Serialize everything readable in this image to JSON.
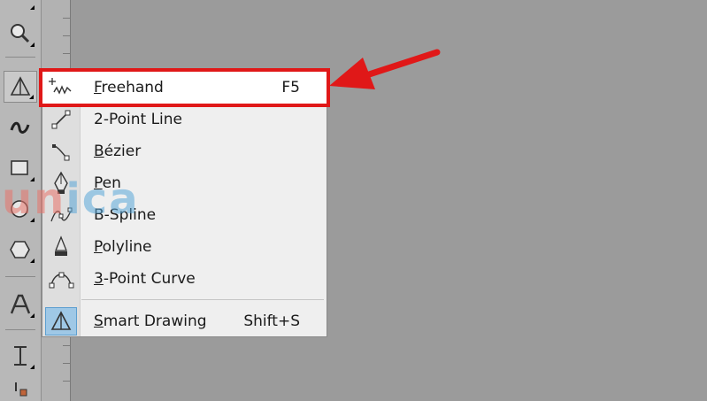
{
  "toolbox": {
    "tools": [
      {
        "name": "zoom-tool",
        "icon": "zoom-icon"
      },
      {
        "name": "freehand-tool",
        "icon": "freehand-triangle-icon",
        "active": true
      },
      {
        "name": "artistic-media-tool",
        "icon": "artistic-media-icon"
      },
      {
        "name": "rectangle-tool",
        "icon": "rectangle-icon"
      },
      {
        "name": "ellipse-tool",
        "icon": "ellipse-icon"
      },
      {
        "name": "polygon-tool",
        "icon": "polygon-icon"
      },
      {
        "name": "text-tool",
        "icon": "text-icon"
      },
      {
        "name": "dimension-tool",
        "icon": "dimension-icon"
      }
    ]
  },
  "menu": {
    "items": [
      {
        "key": "F",
        "rest": "reehand",
        "shortcut": "F5",
        "icon": "freehand-icon"
      },
      {
        "key": "",
        "rest": "2-Point Line",
        "shortcut": "",
        "icon": "two-point-line-icon"
      },
      {
        "key": "B",
        "rest": "ézier",
        "shortcut": "",
        "icon": "bezier-icon"
      },
      {
        "key": "P",
        "rest": "en",
        "shortcut": "",
        "icon": "pen-icon"
      },
      {
        "key": "",
        "rest": "B-Spline",
        "shortcut": "",
        "icon": "b-spline-icon"
      },
      {
        "key": "P",
        "rest": "olyline",
        "shortcut": "",
        "icon": "polyline-icon"
      },
      {
        "key": "3",
        "rest": "-Point Curve",
        "shortcut": "",
        "icon": "three-point-curve-icon"
      },
      {
        "key": "S",
        "rest": "mart Drawing",
        "shortcut": "Shift+S",
        "icon": "smart-drawing-icon"
      }
    ]
  },
  "watermark": {
    "part1": "un",
    "part2": "ica"
  },
  "colors": {
    "highlight_border": "#e01818",
    "arrow": "#e01818",
    "smart_icon_bg": "#9fc8e6"
  }
}
